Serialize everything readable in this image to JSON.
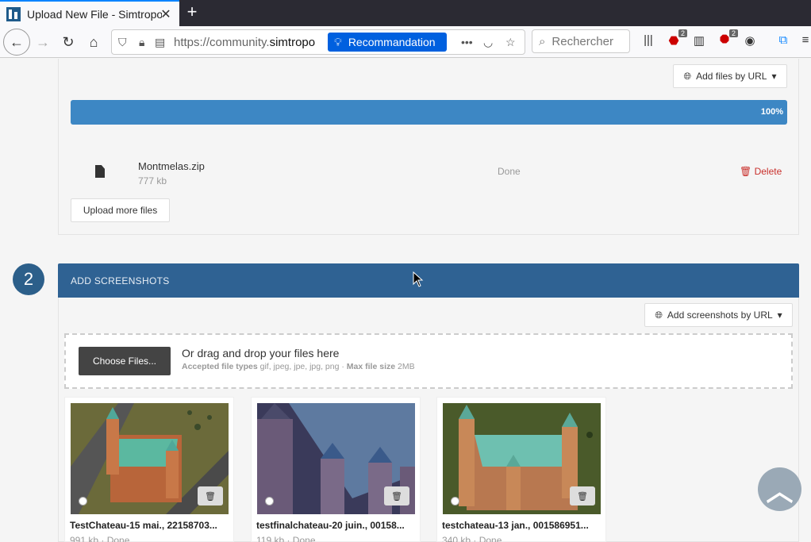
{
  "browser": {
    "tab_title": "Upload New File - Simtropolis",
    "url_prefix": "https://community.",
    "url_domain": "simtropo",
    "reco_label": "Recommandation",
    "search_placeholder": "Rechercher",
    "ublock_badge": "2",
    "abp_badge": "2"
  },
  "upload_panel": {
    "add_files_url_label": "Add files by URL",
    "progress_value": 1.0,
    "progress_label": "100%",
    "file": {
      "name": "Montmelas.zip",
      "size": "777 kb",
      "status": "Done",
      "delete_label": "Delete"
    },
    "upload_more_label": "Upload more files"
  },
  "screenshots": {
    "step_number": "2",
    "title": "ADD SCREENSHOTS",
    "add_url_label": "Add screenshots by URL",
    "choose_label": "Choose Files...",
    "drop_text": "Or drag and drop your files here",
    "accepted_label": "Accepted file types",
    "accepted_types": "gif, jpeg, jpe, jpg, png",
    "max_size_label": "Max file size",
    "max_size": "2MB",
    "items": [
      {
        "name": "TestChateau-15 mai., 22158703...",
        "meta": "991 kb · Done"
      },
      {
        "name": "testfinalchateau-20 juin., 00158...",
        "meta": "119 kb · Done"
      },
      {
        "name": "testchateau-13 jan., 001586951...",
        "meta": "340 kb · Done"
      }
    ]
  },
  "icons": {
    "globe": "globe-icon",
    "file": "file-icon",
    "trash": "trash-icon",
    "arrow_up": "chevron-up-icon"
  }
}
